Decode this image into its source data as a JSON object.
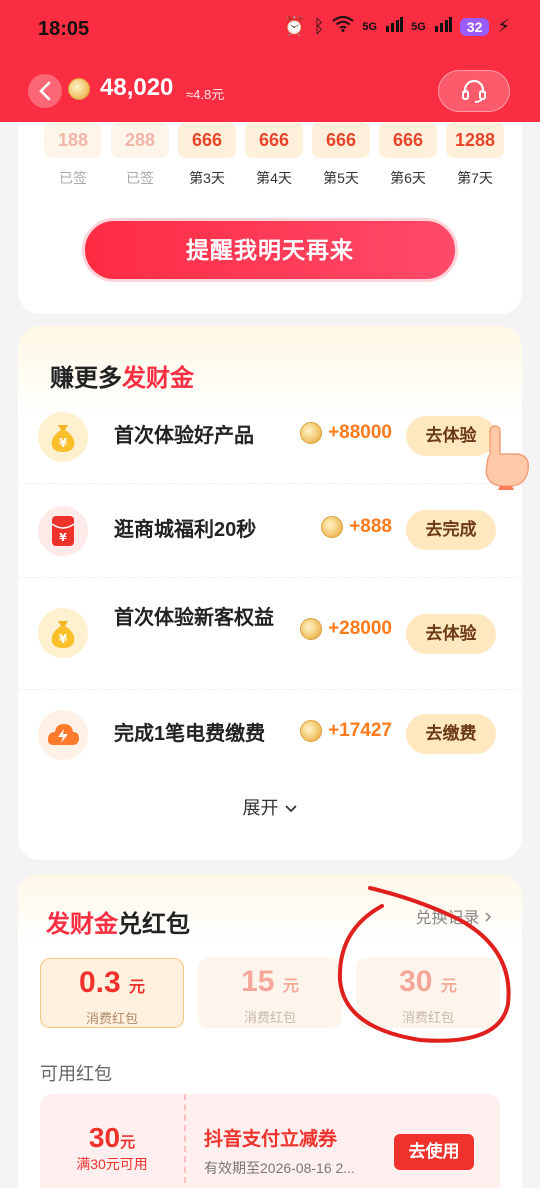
{
  "status_bar": {
    "time": "18:05",
    "battery": "32",
    "signal_label": "5G"
  },
  "header": {
    "back_icon": "chevron-left-icon",
    "balance": "48,020",
    "approx": "≈4.8元",
    "service_icon": "headset-icon"
  },
  "checkin": {
    "days": [
      {
        "amount": "188",
        "label": "已签",
        "done": true
      },
      {
        "amount": "288",
        "label": "已签",
        "done": true
      },
      {
        "amount": "666",
        "label": "第3天",
        "done": false
      },
      {
        "amount": "666",
        "label": "第4天",
        "done": false
      },
      {
        "amount": "666",
        "label": "第5天",
        "done": false
      },
      {
        "amount": "666",
        "label": "第6天",
        "done": false
      },
      {
        "amount": "1288",
        "label": "第7天",
        "done": false
      }
    ],
    "remind_button": "提醒我明天再来"
  },
  "earn": {
    "title_prefix": "赚更多",
    "title_highlight": "发财金",
    "tasks": [
      {
        "name": "首次体验好产品",
        "reward": "+88000",
        "button": "去体验",
        "icon": "money-bag-icon"
      },
      {
        "name": "逛商城福利20秒",
        "reward": "+888",
        "button": "去完成",
        "icon": "red-envelope-icon"
      },
      {
        "name": "首次体验新客权益",
        "reward": "+28000",
        "button": "去体验",
        "icon": "money-bag-icon"
      },
      {
        "name": "完成1笔电费缴费",
        "reward": "+17427",
        "button": "去缴费",
        "icon": "lightning-icon"
      }
    ],
    "expand": "展开"
  },
  "exchange": {
    "title_highlight": "发财金",
    "title_suffix": "兑红包",
    "record": "兑换记录",
    "packs": [
      {
        "amount": "0.3",
        "unit": "元",
        "sub": "消费红包",
        "selected": true
      },
      {
        "amount": "15",
        "unit": "元",
        "sub": "消费红包",
        "selected": false
      },
      {
        "amount": "30",
        "unit": "元",
        "sub": "消费红包",
        "selected": false
      }
    ],
    "available_label": "可用红包",
    "coupon": {
      "amount": "30",
      "unit": "元",
      "condition": "满30元可用",
      "title": "抖音支付立减券",
      "expiry": "有效期至2026-08-16 2...",
      "button": "去使用"
    }
  },
  "colors": {
    "brand_red": "#fb2d42",
    "reward_orange": "#ff7a1a",
    "button_gold": "#ffe7bf"
  }
}
